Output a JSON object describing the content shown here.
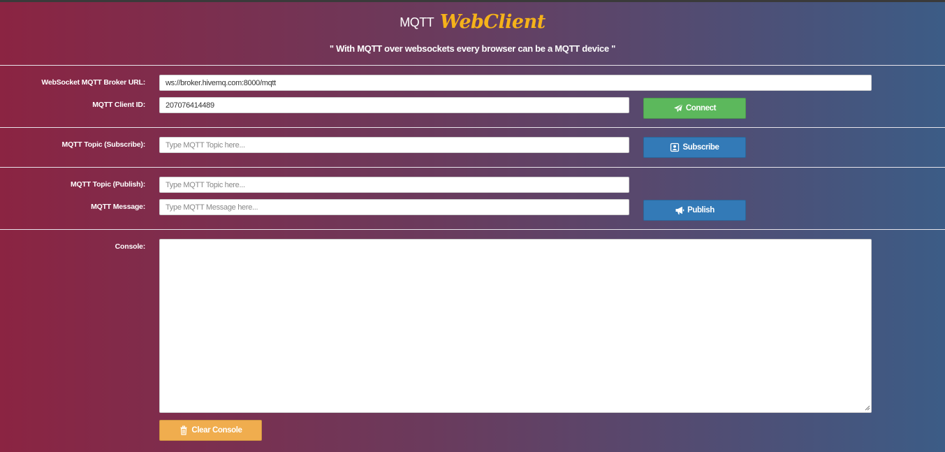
{
  "header": {
    "title_small": "MQTT",
    "title_big": "WebClient",
    "subtitle": "\" With MQTT over websockets every browser can be a MQTT device \""
  },
  "connection": {
    "broker_label": "WebSocket MQTT Broker URL:",
    "broker_value": "ws://broker.hivemq.com:8000/mqtt",
    "client_label": "MQTT Client ID:",
    "client_value": "207076414489",
    "connect_label": "Connect",
    "connect_icon": "paper-plane-icon"
  },
  "subscribe": {
    "topic_label": "MQTT Topic (Subscribe):",
    "topic_placeholder": "Type MQTT Topic here...",
    "subscribe_label": "Subscribe",
    "subscribe_icon": "user-square-icon"
  },
  "publish": {
    "topic_label": "MQTT Topic (Publish):",
    "topic_placeholder": "Type MQTT Topic here...",
    "message_label": "MQTT Message:",
    "message_placeholder": "Type MQTT Message here...",
    "publish_label": "Publish",
    "publish_icon": "megaphone-icon"
  },
  "console": {
    "label": "Console:",
    "value": "",
    "clear_label": "Clear Console",
    "clear_icon": "trash-icon"
  },
  "colors": {
    "gradient_left": "#8b2442",
    "gradient_right": "#3c5c86",
    "title_accent": "#f5b21a",
    "connect_button": "#5cb85c",
    "subscribe_button": "#337ab7",
    "publish_button": "#337ab7",
    "clear_button": "#f0ad4e"
  }
}
